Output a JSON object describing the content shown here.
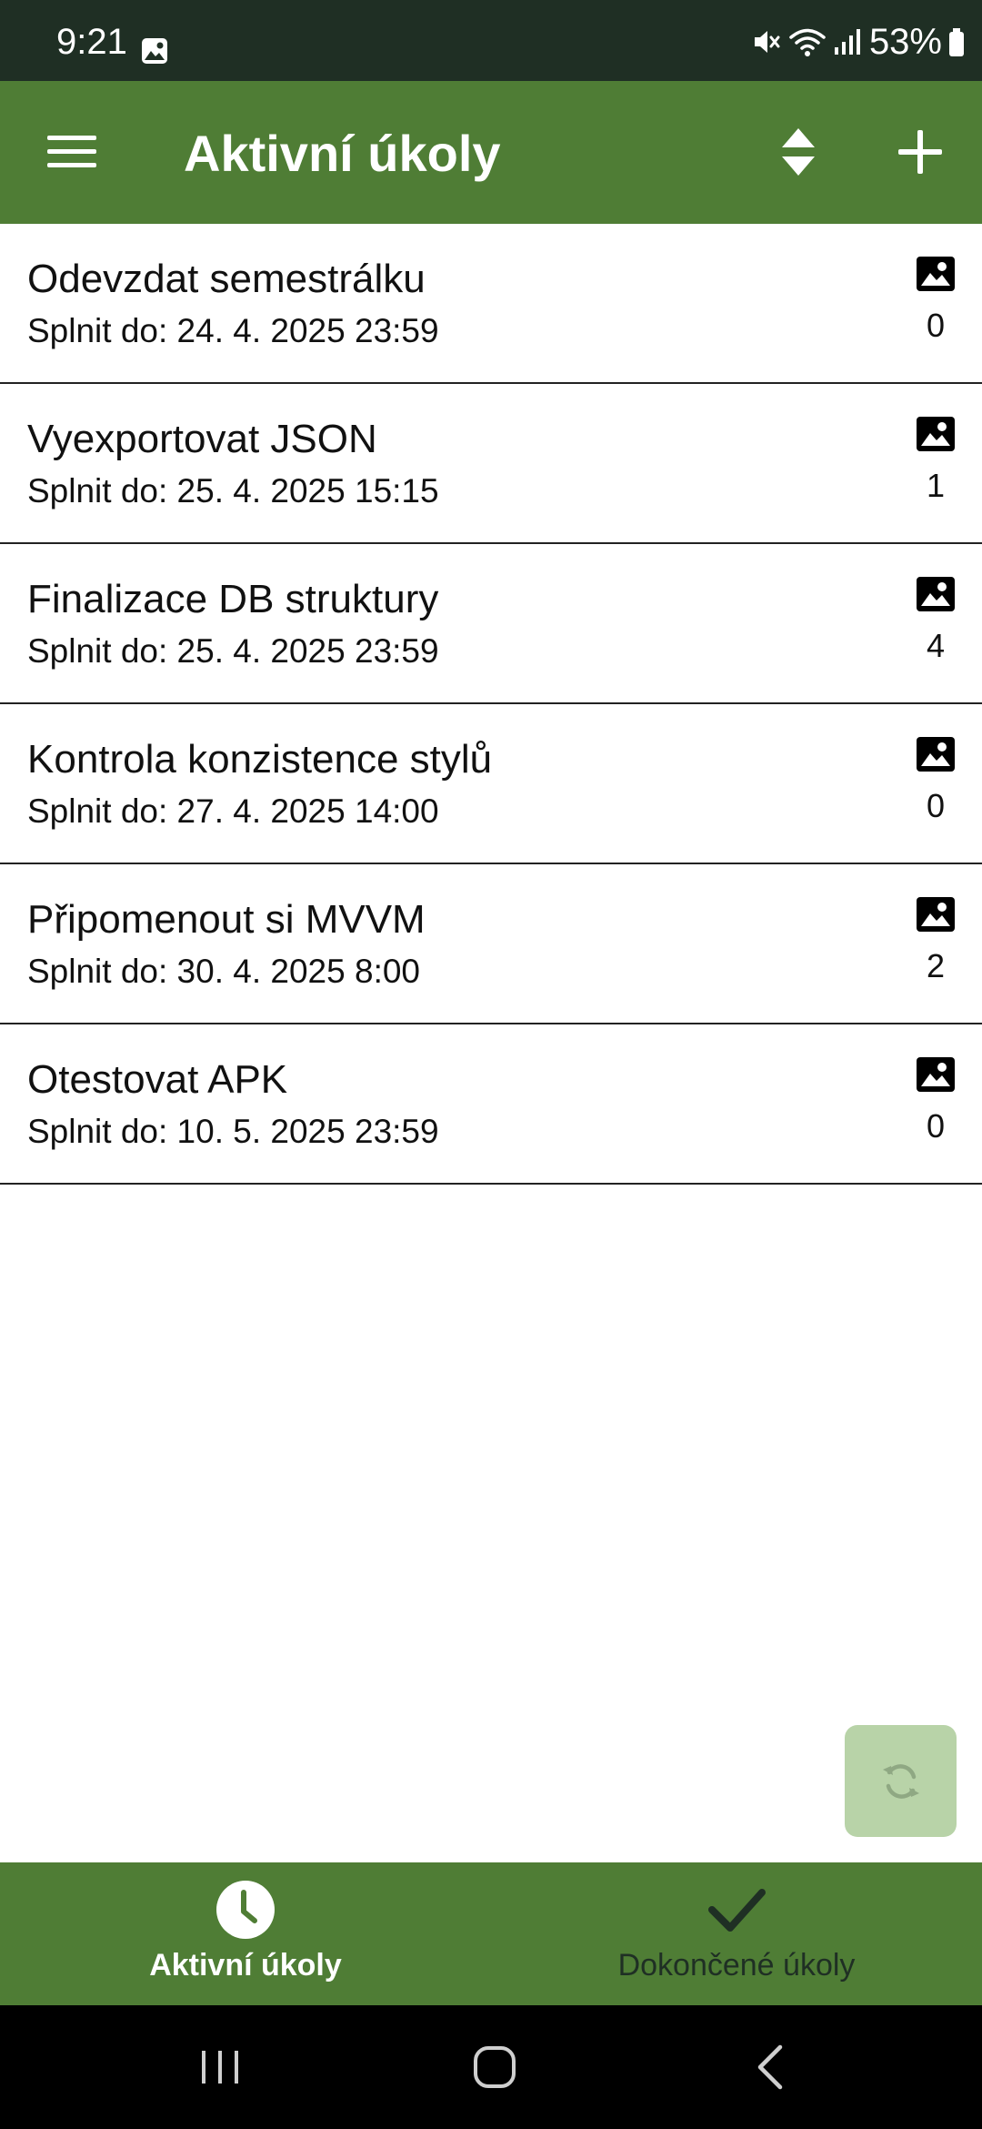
{
  "status_bar": {
    "time": "9:21",
    "battery": "53%",
    "icons": [
      "gallery-icon",
      "mute-icon",
      "wifi-icon",
      "signal-icon",
      "battery-icon"
    ]
  },
  "app_bar": {
    "title": "Aktivní úkoly",
    "icons": [
      "menu-icon",
      "sort-icon",
      "add-icon"
    ]
  },
  "tasks": [
    {
      "title": "Odevzdat semestrálku",
      "due": "Splnit do: 24. 4. 2025 23:59",
      "images": "0"
    },
    {
      "title": "Vyexportovat JSON",
      "due": "Splnit do: 25. 4. 2025 15:15",
      "images": "1"
    },
    {
      "title": "Finalizace DB struktury",
      "due": "Splnit do: 25. 4. 2025 23:59",
      "images": "4"
    },
    {
      "title": "Kontrola konzistence stylů",
      "due": "Splnit do: 27. 4. 2025 14:00",
      "images": "0"
    },
    {
      "title": "Připomenout si MVVM",
      "due": "Splnit do: 30. 4. 2025 8:00",
      "images": "2"
    },
    {
      "title": "Otestovat APK",
      "due": "Splnit do: 10. 5. 2025 23:59",
      "images": "0"
    }
  ],
  "sync_button": {
    "icon": "refresh-icon",
    "state": "disabled"
  },
  "bottom_nav": {
    "tabs": [
      {
        "label": "Aktivní úkoly",
        "icon": "clock-icon",
        "selected": true
      },
      {
        "label": "Dokončené úkoly",
        "icon": "check-icon",
        "selected": false
      }
    ]
  },
  "system_nav": {
    "icons": [
      "recents-icon",
      "home-icon",
      "back-icon"
    ]
  },
  "colors": {
    "status_bar": "#1f2f24",
    "primary": "#4f7d35",
    "sync_button": "#b8d3a8",
    "divider": "#222222",
    "text": "#111111",
    "nav_inactive": "#1f2f24"
  }
}
